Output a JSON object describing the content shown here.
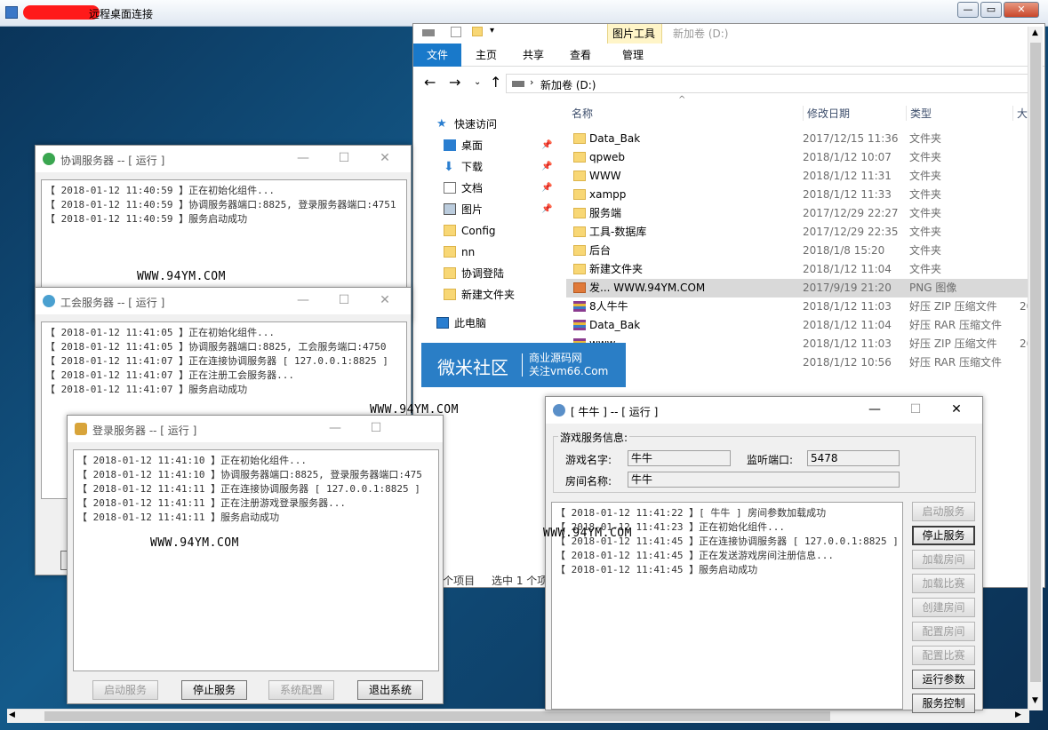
{
  "rdp": {
    "title": "远程桌面连接"
  },
  "coordinator": {
    "title": "协调服务器 -- [ 运行 ]",
    "log": [
      "【 2018-01-12 11:40:59 】正在初始化组件...",
      "【 2018-01-12 11:40:59 】协调服务器端口:8825, 登录服务器端口:4751",
      "【 2018-01-12 11:40:59 】服务启动成功"
    ]
  },
  "guild": {
    "title": "工会服务器 -- [ 运行 ]",
    "log": [
      "【 2018-01-12 11:41:05 】正在初始化组件...",
      "【 2018-01-12 11:41:05 】协调服务器端口:8825, 工会服务端口:4750",
      "【 2018-01-12 11:41:07 】正在连接协调服务器 [ 127.0.0.1:8825 ]",
      "【 2018-01-12 11:41:07 】正在注册工会服务器...",
      "【 2018-01-12 11:41:07 】服务启动成功"
    ]
  },
  "login": {
    "title": "登录服务器 -- [ 运行 ]",
    "log": [
      "【 2018-01-12 11:41:10 】正在初始化组件...",
      "【 2018-01-12 11:41:10 】协调服务器端口:8825, 登录服务器端口:475",
      "【 2018-01-12 11:41:11 】正在连接协调服务器 [ 127.0.0.1:8825 ]",
      "【 2018-01-12 11:41:11 】正在注册游戏登录服务器...",
      "【 2018-01-12 11:41:11 】服务启动成功"
    ],
    "buttons": [
      "启动服务",
      "停止服务",
      "系统配置",
      "退出系统"
    ]
  },
  "watermark": "WWW.94YM.COM",
  "banner": {
    "main": "微米社区",
    "line1": "商业源码网",
    "line2": "关注vm66.Com"
  },
  "explorer": {
    "title": "新加卷 (D:)",
    "picture_tools": "图片工具",
    "tabs": [
      "文件",
      "主页",
      "共享",
      "查看",
      "管理"
    ],
    "path": "新加卷 (D:)",
    "nav": [
      "快速访问",
      "桌面",
      "下载",
      "文档",
      "图片",
      "Config",
      "nn",
      "协调登陆",
      "新建文件夹",
      "此电脑"
    ],
    "columns": {
      "name": "名称",
      "date": "修改日期",
      "type": "类型",
      "size": "大"
    },
    "files": [
      {
        "name": "Data_Bak",
        "date": "2017/12/15 11:36",
        "type": "文件夹",
        "extra": ""
      },
      {
        "name": "qpweb",
        "date": "2018/1/12 10:07",
        "type": "文件夹",
        "extra": ""
      },
      {
        "name": "WWW",
        "date": "2018/1/12 11:31",
        "type": "文件夹",
        "extra": ""
      },
      {
        "name": "xampp",
        "date": "2018/1/12 11:33",
        "type": "文件夹",
        "extra": ""
      },
      {
        "name": "服务端",
        "date": "2017/12/29 22:27",
        "type": "文件夹",
        "extra": ""
      },
      {
        "name": "工具-数据库",
        "date": "2017/12/29 22:35",
        "type": "文件夹",
        "extra": ""
      },
      {
        "name": "后台",
        "date": "2018/1/8 15:20",
        "type": "文件夹",
        "extra": ""
      },
      {
        "name": "新建文件夹",
        "date": "2018/1/12 11:04",
        "type": "文件夹",
        "extra": ""
      },
      {
        "name": "发... WWW.94YM.COM",
        "date": "2017/9/19 21:20",
        "type": "PNG 图像",
        "extra": ""
      },
      {
        "name": "8人牛牛",
        "date": "2018/1/12 11:03",
        "type": "好压 ZIP 压缩文件",
        "extra": "20"
      },
      {
        "name": "Data_Bak",
        "date": "2018/1/12 11:04",
        "type": "好压 RAR 压缩文件",
        "extra": ""
      },
      {
        "name": "www",
        "date": "2018/1/12 11:03",
        "type": "好压 ZIP 压缩文件",
        "extra": "26"
      },
      {
        "name": "",
        "date": "2018/1/12 10:56",
        "type": "好压 RAR 压缩文件",
        "extra": ""
      }
    ],
    "status_count": "13 个项目",
    "status_selected": "选中 1 个项"
  },
  "game": {
    "title": "[ 牛牛 ] -- [ 运行 ]",
    "group_label": "游戏服务信息:",
    "game_name_label": "游戏名字:",
    "game_name": "牛牛",
    "port_label": "监听端口:",
    "port": "5478",
    "room_label": "房间名称:",
    "room": "牛牛",
    "log": [
      "【 2018-01-12 11:41:22 】[ 牛牛 ] 房间参数加载成功",
      "【 2018-01-12 11:41:23 】正在初始化组件...",
      "【 2018-01-12 11:41:45 】正在连接协调服务器 [ 127.0.0.1:8825 ]",
      "【 2018-01-12 11:41:45 】正在发送游戏房间注册信息...",
      "【 2018-01-12 11:41:45 】服务启动成功"
    ],
    "buttons": [
      "启动服务",
      "停止服务",
      "加载房间",
      "加载比赛",
      "创建房间",
      "配置房间",
      "配置比赛",
      "运行参数",
      "服务控制"
    ]
  }
}
